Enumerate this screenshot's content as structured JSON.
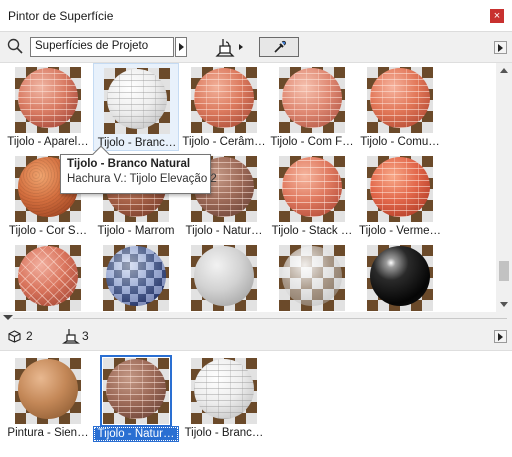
{
  "window": {
    "title": "Pintor de Superfície",
    "close_symbol": "×"
  },
  "toolbar": {
    "search_value": "Superfícies de Projeto"
  },
  "library_tiles": [
    {
      "label": "Tijolo - Aparel…",
      "sphere": "radial-gradient(circle at 38% 32%, #f0b6a4 0%, #d97b63 45%, #a5483a 85%, #6a2c24 100%)",
      "pattern": "brick"
    },
    {
      "label": "Tijolo - Branc…",
      "sphere": "radial-gradient(circle at 38% 32%, #ffffff 0%, #eeeeee 45%, #c4c4c4 85%, #8d8d8d 100%)",
      "pattern": "brick-light"
    },
    {
      "label": "Tijolo - Cerâm…",
      "sphere": "radial-gradient(circle at 38% 32%, #f2b19a 0%, #dc7a5e 45%, #ad4f3a 85%, #6f3024 100%)",
      "pattern": "brick"
    },
    {
      "label": "Tijolo - Com F…",
      "sphere": "radial-gradient(circle at 38% 32%, #f6c2b0 0%, #e08a74 45%, #b65a48 85%, #763428 100%)",
      "pattern": "brick"
    },
    {
      "label": "Tijolo - Comu…",
      "sphere": "radial-gradient(circle at 38% 32%, #f6b39e 0%, #e27758 45%, #b44a34 85%, #722b20 100%)",
      "pattern": "brick"
    },
    {
      "label": "Tijolo - Cor S…",
      "sphere": "radial-gradient(circle at 38% 32%, #f0a570 0%, #d36e3e 45%, #9f4522 85%, #5e2812 100%)",
      "pattern": "rough"
    },
    {
      "label": "Tijolo - Marrom",
      "sphere": "radial-gradient(circle at 38% 32%, #d09a7e 0%, #a86248 45%, #7a3e2c 85%, #4a241a 100%)",
      "pattern": "brick"
    },
    {
      "label": "Tijolo - Natur…",
      "sphere": "radial-gradient(circle at 38% 32%, #c49986 0%, #9d6a58 45%, #6f463a 85%, #432822 100%)",
      "pattern": "brick"
    },
    {
      "label": "Tijolo - Stack …",
      "sphere": "radial-gradient(circle at 38% 32%, #f6b7a0 0%, #e07a60 45%, #b54d3a 85%, #732e22 100%)",
      "pattern": "stack"
    },
    {
      "label": "Tijolo - Verme…",
      "sphere": "radial-gradient(circle at 38% 32%, #f8a888 0%, #e2674a 45%, #b23c28 85%, #6e2218 100%)",
      "pattern": "brick"
    },
    {
      "label": "",
      "sphere": "radial-gradient(circle at 38% 32%, #f2b0a0 0%, #d9745c 45%, #a84a38 85%, #6a2c22 100%)",
      "pattern": "herringbone"
    },
    {
      "label": "",
      "sphere": "radial-gradient(circle at 38% 32%, #c8d4ee 0%, #6d84c0 45%, #2b3f86 85%, #141e48 100%)",
      "pattern": "checker"
    },
    {
      "label": "",
      "sphere": "radial-gradient(circle at 38% 32%, #f2f2f2 0%, #d2d2d2 45%, #a6a6a6 85%, #707070 100%)",
      "pattern": "none"
    },
    {
      "label": "",
      "sphere": "radial-gradient(circle at 38% 32%, rgba(255,255,255,0.9) 0%, rgba(230,230,230,0.5) 45%, rgba(170,170,170,0.45) 85%, rgba(120,120,120,0.6) 100%)",
      "pattern": "none"
    },
    {
      "label": "",
      "sphere": "radial-gradient(circle at 35% 28%, #ffffff 0%, #9a9a9a 8%, #2a2a2a 30%, #050505 70%, #1a1a1a 100%)",
      "pattern": "none"
    }
  ],
  "tooltip": {
    "title": "Tijolo - Branco Natural",
    "subtitle": "Hachura V.: Tijolo Elevação 2"
  },
  "stats": {
    "surface_count": "2",
    "paint_count": "3"
  },
  "project_tiles": [
    {
      "label": "Pintura - Sien…",
      "sphere": "radial-gradient(circle at 38% 32%, #e8b890 0%, #c48858 45%, #936036 85%, #5a3a20 100%)",
      "pattern": "none"
    },
    {
      "label": "Tijolo - Natur…",
      "sphere": "radial-gradient(circle at 38% 32%, #c49986 0%, #9d6a58 45%, #6f463a 85%, #432822 100%)",
      "pattern": "brick"
    },
    {
      "label": "Tijolo - Branc…",
      "sphere": "radial-gradient(circle at 38% 32%, #ffffff 0%, #eeeeee 45%, #c4c4c4 85%, #8d8d8d 100%)",
      "pattern": "brick-light"
    }
  ]
}
